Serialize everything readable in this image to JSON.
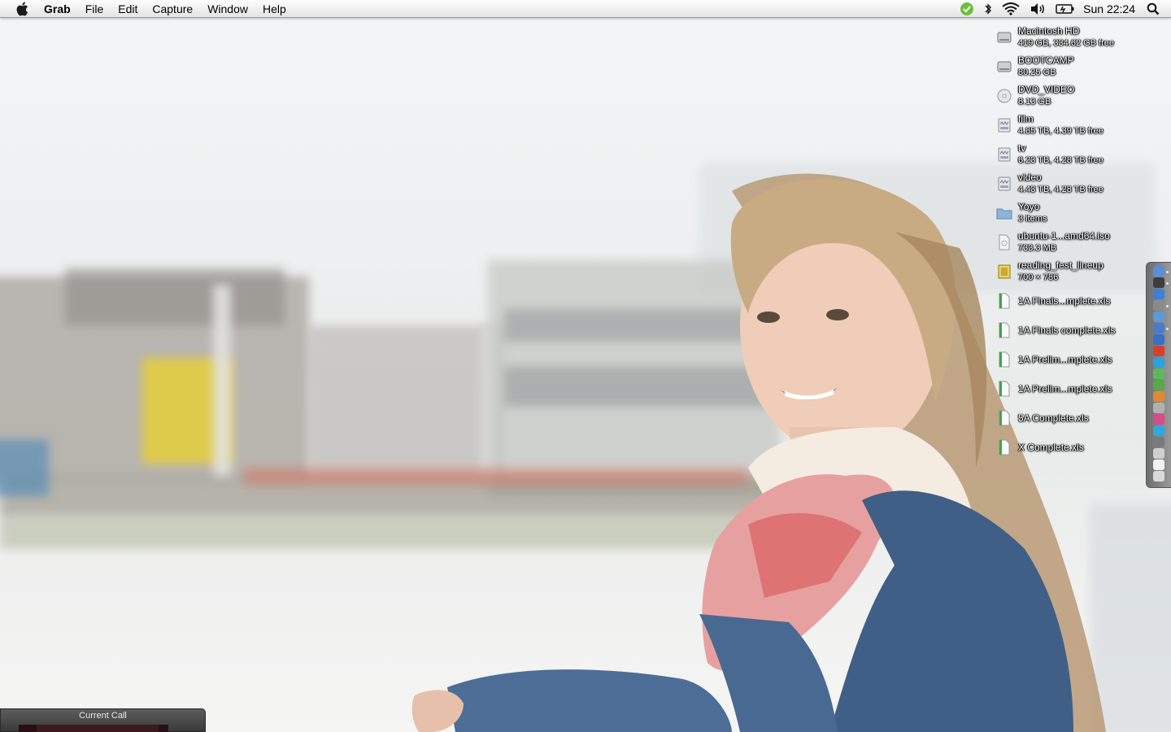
{
  "menubar": {
    "app_name": "Grab",
    "items": [
      "File",
      "Edit",
      "Capture",
      "Window",
      "Help"
    ],
    "clock": "Sun 22:24",
    "status_icons": [
      "evernote-icon",
      "bluetooth-icon",
      "wifi-icon",
      "volume-icon",
      "battery-icon",
      "spotlight-icon"
    ]
  },
  "desktop": {
    "items": [
      {
        "name": "Macintosh HD",
        "sub": "419 GB, 334.62 GB free",
        "icon": "hard-drive-icon"
      },
      {
        "name": "BOOTCAMP",
        "sub": "80.25 GB",
        "icon": "hard-drive-icon"
      },
      {
        "name": "DVD_VIDEO",
        "sub": "8.13 GB",
        "icon": "dvd-icon"
      },
      {
        "name": "film",
        "sub": "4.85 TB, 4.39 TB free",
        "icon": "network-drive-icon"
      },
      {
        "name": "tv",
        "sub": "6.23 TB, 4.28 TB free",
        "icon": "network-drive-icon"
      },
      {
        "name": "video",
        "sub": "4.43 TB, 4.28 TB free",
        "icon": "network-drive-icon"
      },
      {
        "name": "Yoyo",
        "sub": "3 items",
        "icon": "folder-icon"
      },
      {
        "name": "ubuntu-1...amd64.iso",
        "sub": "733.3 MB",
        "icon": "disk-image-icon"
      },
      {
        "name": "reading_fest_lineup",
        "sub": "700 × 786",
        "icon": "image-file-icon"
      },
      {
        "name": "1A Finals...mplete.xls",
        "sub": "",
        "icon": "spreadsheet-icon"
      },
      {
        "name": "1A Finals complete.xls",
        "sub": "",
        "icon": "spreadsheet-icon"
      },
      {
        "name": "1A Prelim...mplete.xls",
        "sub": "",
        "icon": "spreadsheet-icon"
      },
      {
        "name": "1A Prelim...mplete.xls",
        "sub": "",
        "icon": "spreadsheet-icon"
      },
      {
        "name": "5A Complete.xls",
        "sub": "",
        "icon": "spreadsheet-icon"
      },
      {
        "name": "X Complete.xls",
        "sub": "",
        "icon": "spreadsheet-icon"
      }
    ]
  },
  "call_window": {
    "title": "Current Call"
  },
  "mini_dock": {
    "icon_colors": [
      "#5a8fd8",
      "#3d3d3d",
      "#3b82d6",
      "#8a8a8a",
      "#5c9ad8",
      "#4a7cc7",
      "#3b6fc4",
      "#d8402e",
      "#2f9fe0",
      "#5cb85c",
      "#5aa846",
      "#e08a2e",
      "#b0b0b0",
      "#d84a8a",
      "#2ea8e0",
      "#7a7a7a",
      "#cfcfcf",
      "#f2f2f2",
      "#dadada"
    ]
  }
}
